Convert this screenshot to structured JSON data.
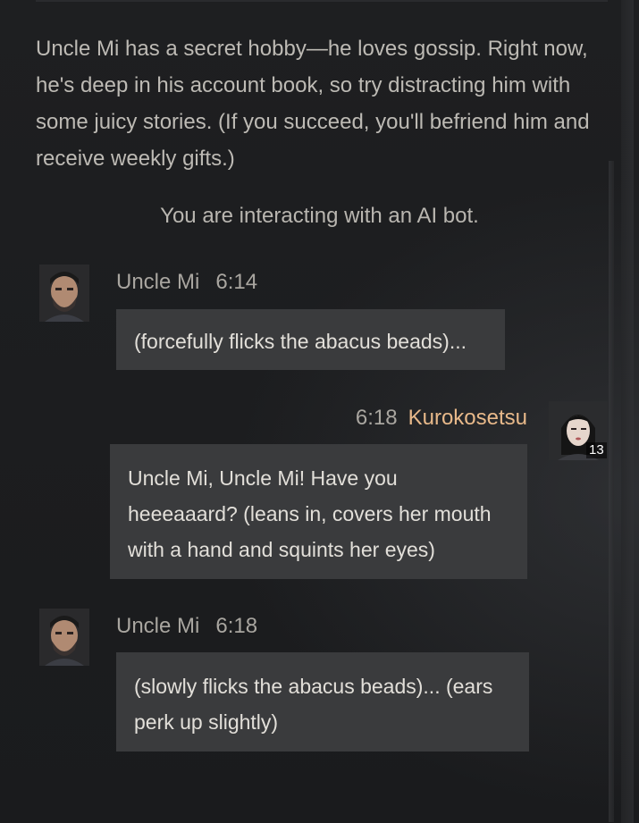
{
  "intro_text": "Uncle Mi has a secret hobby—he loves gossip. Right now, he's deep in his account book, so try distracting him with some juicy stories. (If you succeed, you'll befriend him and receive weekly gifts.)",
  "ai_notice": "You are interacting with an AI bot.",
  "messages": [
    {
      "sender": "Uncle Mi",
      "time": "6:14",
      "text": "(forcefully flicks the abacus beads)...",
      "avatar": "npc-bearded-man-avatar"
    },
    {
      "sender": "Kurokosetsu",
      "time": "6:18",
      "text": "Uncle Mi, Uncle Mi! Have you heeeaaard? (leans in, covers her mouth with a hand and squints her eyes)",
      "avatar": "player-woman-avatar",
      "level": "13"
    },
    {
      "sender": "Uncle Mi",
      "time": "6:18",
      "text": "(slowly flicks the abacus beads)... (ears perk up slightly)",
      "avatar": "npc-bearded-man-avatar"
    }
  ],
  "colors": {
    "background": "#1c1d1f",
    "bubble": "#3a3b3d",
    "player_name": "#e8b98a"
  }
}
